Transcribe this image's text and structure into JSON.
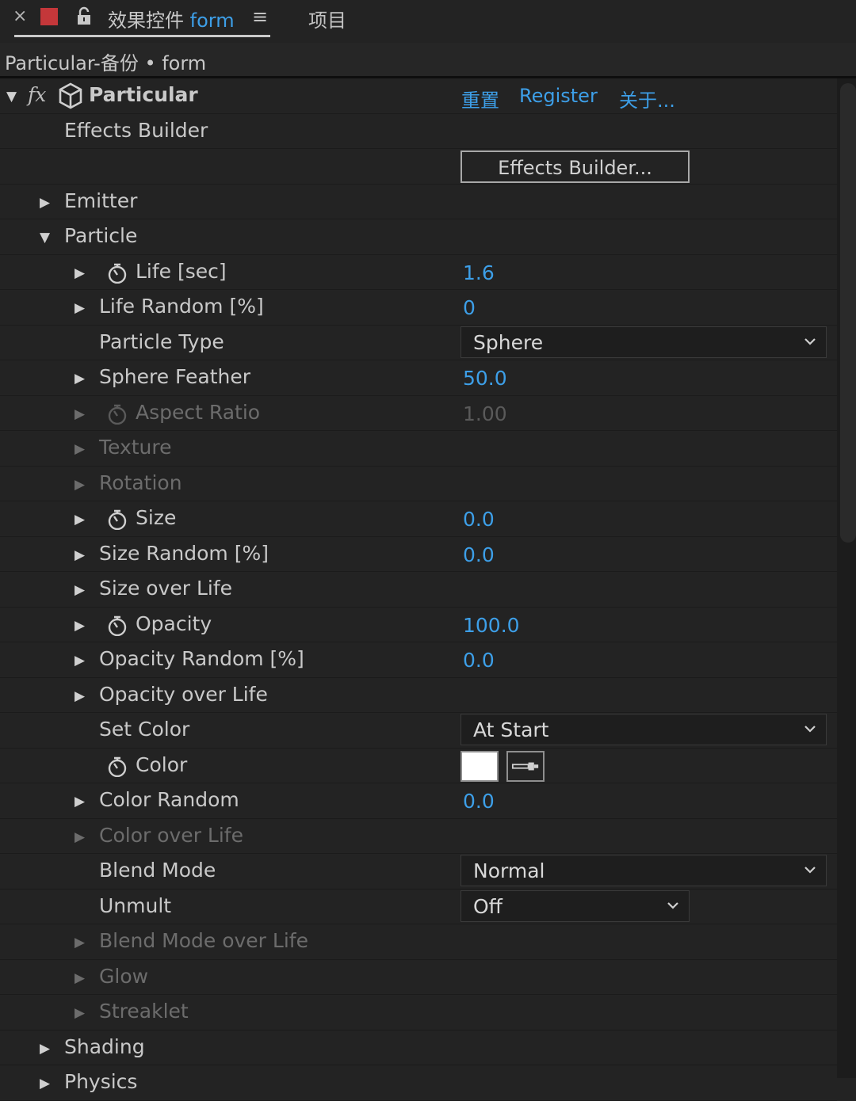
{
  "tabbar": {
    "close_glyph": "×",
    "title_cn": "效果控件",
    "title_comp": "form",
    "menu_glyph": "≡",
    "project_tab": "项目",
    "swatch_color": "#c4373a"
  },
  "breadcrumb": "Particular-备份 • form",
  "effect": {
    "name": "Particular",
    "reset": "重置",
    "register": "Register",
    "about": "关于..."
  },
  "rows": {
    "effects_builder_label": "Effects Builder",
    "effects_builder_button": "Effects Builder...",
    "emitter": "Emitter",
    "particle": "Particle",
    "life": {
      "label": "Life [sec]",
      "value": "1.6"
    },
    "life_random": {
      "label": "Life Random [%]",
      "value": "0"
    },
    "particle_type": {
      "label": "Particle Type",
      "value": "Sphere"
    },
    "sphere_feather": {
      "label": "Sphere Feather",
      "value": "50.0"
    },
    "aspect_ratio": {
      "label": "Aspect Ratio",
      "value": "1.00"
    },
    "texture": "Texture",
    "rotation": "Rotation",
    "size": {
      "label": "Size",
      "value": "0.0"
    },
    "size_random": {
      "label": "Size Random [%]",
      "value": "0.0"
    },
    "size_over_life": "Size over Life",
    "opacity": {
      "label": "Opacity",
      "value": "100.0"
    },
    "opacity_random": {
      "label": "Opacity Random [%]",
      "value": "0.0"
    },
    "opacity_over_life": "Opacity over Life",
    "set_color": {
      "label": "Set Color",
      "value": "At Start"
    },
    "color": {
      "label": "Color",
      "swatch": "#ffffff"
    },
    "color_random": {
      "label": "Color Random",
      "value": "0.0"
    },
    "color_over_life": "Color over Life",
    "blend_mode": {
      "label": "Blend Mode",
      "value": "Normal"
    },
    "unmult": {
      "label": "Unmult",
      "value": "Off"
    },
    "blend_mode_over_life": "Blend Mode over Life",
    "glow": "Glow",
    "streaklet": "Streaklet",
    "shading": "Shading",
    "physics": "Physics"
  },
  "colors": {
    "accent": "#3d9fe8",
    "background": "#232323",
    "text": "#c9c9c9",
    "dim_text": "#6c6c6c"
  }
}
